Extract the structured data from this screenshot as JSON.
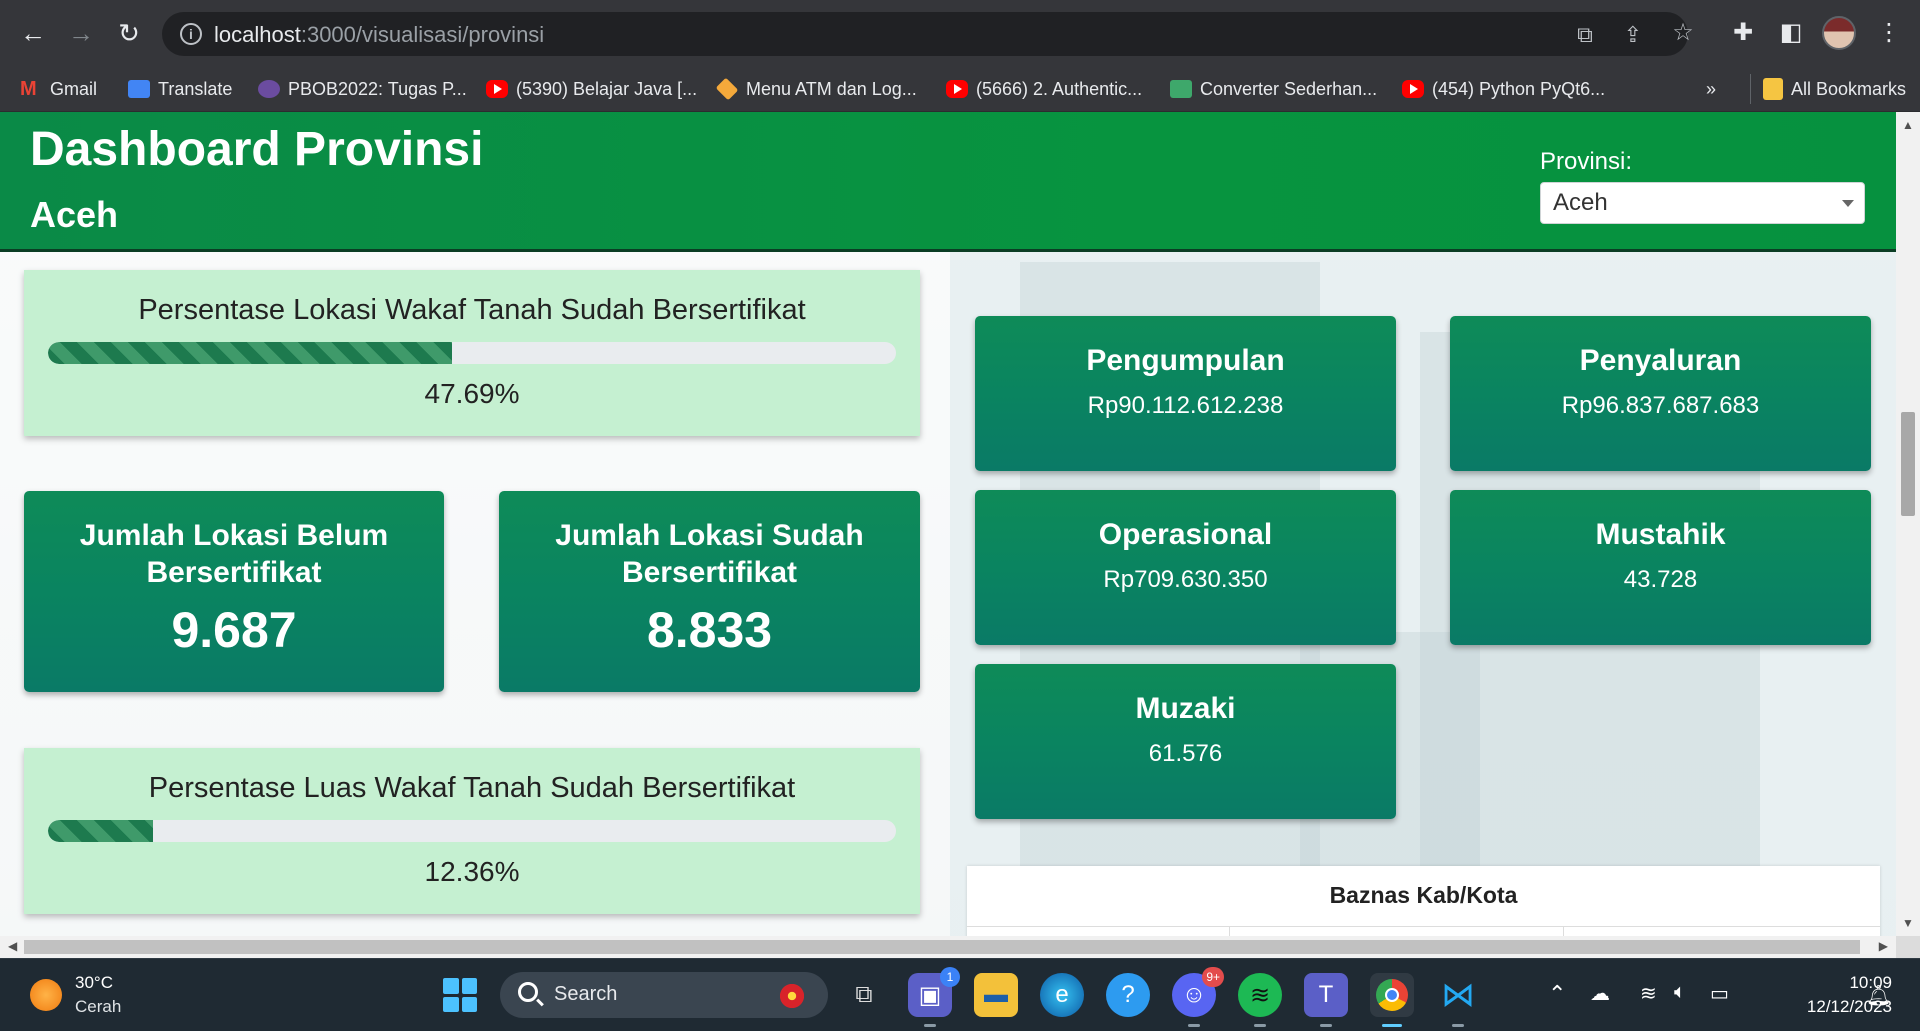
{
  "browser": {
    "url_host": "localhost",
    "url_path": ":3000/visualisasi/provinsi",
    "bookmarks": [
      {
        "label": "Gmail",
        "icon": "gmail-icon"
      },
      {
        "label": "Translate",
        "icon": "translate-icon"
      },
      {
        "label": "PBOB2022: Tugas P...",
        "icon": "pbob-icon"
      },
      {
        "label": "(5390) Belajar Java [...",
        "icon": "youtube-icon"
      },
      {
        "label": "Menu ATM dan Log...",
        "icon": "box-icon"
      },
      {
        "label": "(5666) 2. Authentic...",
        "icon": "youtube-icon"
      },
      {
        "label": "Converter Sederhan...",
        "icon": "cube-icon"
      },
      {
        "label": "(454) Python PyQt6...",
        "icon": "youtube-icon"
      }
    ],
    "more_bookmarks": "»",
    "all_bookmarks": "All Bookmarks"
  },
  "header": {
    "title": "Dashboard Provinsi",
    "subtitle": "Aceh",
    "province_label": "Provinsi:",
    "province_selected": "Aceh"
  },
  "wakaf": {
    "lokasi_progress": {
      "title": "Persentase Lokasi Wakaf Tanah Sudah Bersertifikat",
      "value_label": "47.69%",
      "value": 47.69
    },
    "belum": {
      "title_line1": "Jumlah Lokasi Belum",
      "title_line2": "Bersertifikat",
      "value": "9.687"
    },
    "sudah": {
      "title_line1": "Jumlah Lokasi Sudah",
      "title_line2": "Bersertifikat",
      "value": "8.833"
    },
    "luas_progress": {
      "title": "Persentase Luas Wakaf Tanah Sudah Bersertifikat",
      "value_label": "12.36%",
      "value": 12.36
    }
  },
  "zakat": {
    "pengumpulan": {
      "title": "Pengumpulan",
      "value": "Rp90.112.612.238"
    },
    "penyaluran": {
      "title": "Penyaluran",
      "value": "Rp96.837.687.683"
    },
    "operasional": {
      "title": "Operasional",
      "value": "Rp709.630.350"
    },
    "mustahik": {
      "title": "Mustahik",
      "value": "43.728"
    },
    "muzaki": {
      "title": "Muzaki",
      "value": "61.576"
    }
  },
  "table": {
    "title": "Baznas Kab/Kota"
  },
  "taskbar": {
    "weather_temp": "30°C",
    "weather_desc": "Cerah",
    "search_placeholder": "Search",
    "teams_badge": "1",
    "discord_badge": "9+",
    "time": "10:09",
    "date": "12/12/2023"
  },
  "colors": {
    "header_green": "#07943f",
    "card_green": "#0a8460",
    "progress_card_bg": "#c5f0d1"
  }
}
